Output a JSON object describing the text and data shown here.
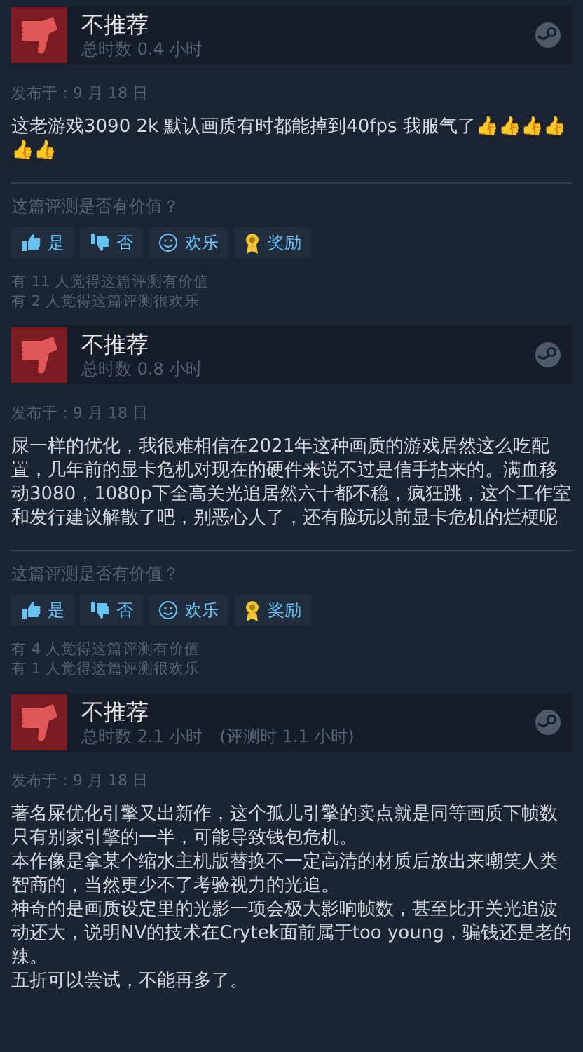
{
  "reviews": [
    {
      "title": "不推荐",
      "hours": "总时数 0.4 小时",
      "date": "发布于：9 月 18 日",
      "paragraphs": [
        "这老游戏3090 2k 默认画质有时都能掉到40fps 我服气了👍👍👍👍👍👍"
      ],
      "question": "这篇评测是否有价值？",
      "buttons": [
        {
          "kind": "yes",
          "label": "是"
        },
        {
          "kind": "no",
          "label": "否"
        },
        {
          "kind": "funny",
          "label": "欢乐"
        },
        {
          "kind": "award",
          "label": "奖励"
        }
      ],
      "stats": [
        "有 11 人觉得这篇评测有价值",
        "有 2 人觉得这篇评测很欢乐"
      ]
    },
    {
      "title": "不推荐",
      "hours": "总时数 0.8 小时",
      "date": "发布于：9 月 18 日",
      "paragraphs": [
        "屎一样的优化，我很难相信在2021年这种画质的游戏居然这么吃配置，几年前的显卡危机对现在的硬件来说不过是信手拈来的。满血移动3080，1080p下全高关光追居然六十都不稳，疯狂跳，这个工作室和发行建议解散了吧，别恶心人了，还有脸玩以前显卡危机的烂梗呢"
      ],
      "question": "这篇评测是否有价值？",
      "buttons": [
        {
          "kind": "yes",
          "label": "是"
        },
        {
          "kind": "no",
          "label": "否"
        },
        {
          "kind": "funny",
          "label": "欢乐"
        },
        {
          "kind": "award",
          "label": "奖励"
        }
      ],
      "stats": [
        "有 4 人觉得这篇评测有价值",
        "有 1 人觉得这篇评测很欢乐"
      ]
    },
    {
      "title": "不推荐",
      "hours": "总时数 2.1 小时",
      "hours_at_review": "(评测时 1.1 小时)",
      "date": "发布于：9 月 18 日",
      "paragraphs": [
        "著名屎优化引擎又出新作，这个孤儿引擎的卖点就是同等画质下帧数只有别家引擎的一半，可能导致钱包危机。",
        "本作像是拿某个缩水主机版替换不一定高清的材质后放出来嘲笑人类智商的，当然更少不了考验视力的光追。",
        "神奇的是画质设定里的光影一项会极大影响帧数，甚至比开关光追波动还大，说明NV的技术在Crytek面前属于too young，骗钱还是老的辣。",
        "五折可以尝试，不能再多了。"
      ]
    }
  ]
}
